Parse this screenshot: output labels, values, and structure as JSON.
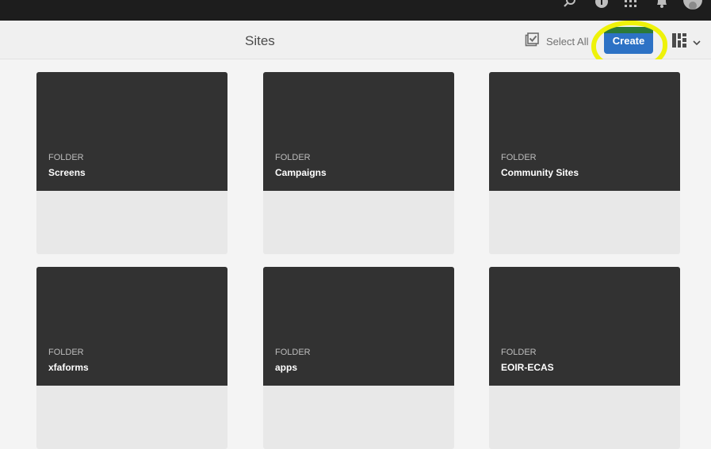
{
  "shell": {
    "icons": [
      "search-icon",
      "help-icon",
      "apps-icon",
      "bell-icon",
      "user-avatar"
    ]
  },
  "actionbar": {
    "title": "Sites",
    "select_all_label": "Select All",
    "create_label": "Create",
    "view_icon": "card-view-icon"
  },
  "colors": {
    "accent": "#2d72c5",
    "highlight": "#eef20a",
    "card_dark": "#323232"
  },
  "cards": [
    {
      "type": "FOLDER",
      "name": "Screens"
    },
    {
      "type": "FOLDER",
      "name": "Campaigns"
    },
    {
      "type": "FOLDER",
      "name": "Community Sites"
    },
    {
      "type": "FOLDER",
      "name": "xfaforms"
    },
    {
      "type": "FOLDER",
      "name": "apps"
    },
    {
      "type": "FOLDER",
      "name": "EOIR-ECAS"
    }
  ]
}
